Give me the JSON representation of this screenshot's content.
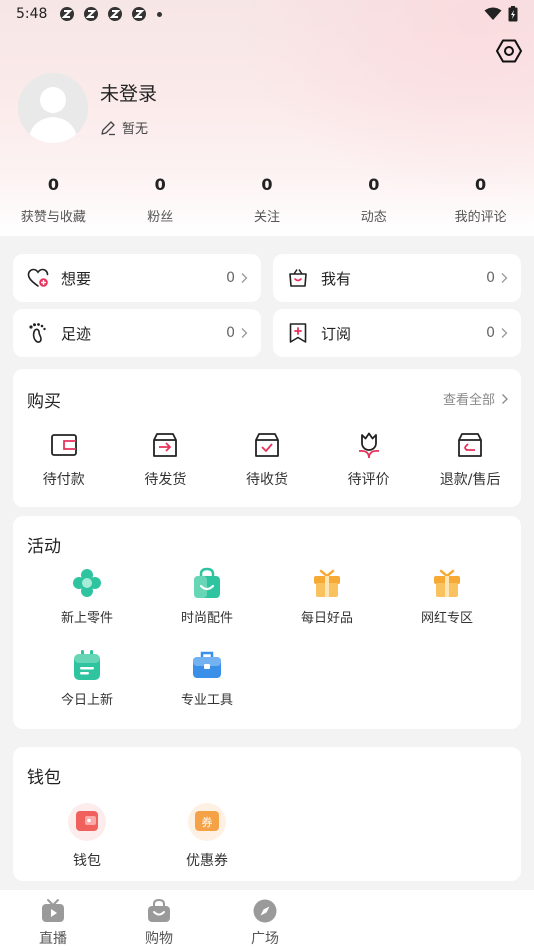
{
  "status_bar": {
    "time": "5:48"
  },
  "profile": {
    "username": "未登录",
    "bio": "暂无"
  },
  "stats": [
    {
      "value": "0",
      "label": "获赞与收藏"
    },
    {
      "value": "0",
      "label": "粉丝"
    },
    {
      "value": "0",
      "label": "关注"
    },
    {
      "value": "0",
      "label": "动态"
    },
    {
      "value": "0",
      "label": "我的评论"
    }
  ],
  "quick": [
    {
      "label": "想要",
      "count": "0",
      "icon": "heart-plus-icon"
    },
    {
      "label": "我有",
      "count": "0",
      "icon": "basket-icon"
    },
    {
      "label": "足迹",
      "count": "0",
      "icon": "footprint-icon"
    },
    {
      "label": "订阅",
      "count": "0",
      "icon": "bookmark-plus-icon"
    }
  ],
  "purchase": {
    "title": "购买",
    "view_all": "查看全部",
    "items": [
      {
        "label": "待付款",
        "icon": "wallet-outline-icon"
      },
      {
        "label": "待发货",
        "icon": "box-arrow-icon"
      },
      {
        "label": "待收货",
        "icon": "box-check-icon"
      },
      {
        "label": "待评价",
        "icon": "tulip-icon"
      },
      {
        "label": "退款/售后",
        "icon": "box-return-icon"
      }
    ]
  },
  "activity": {
    "title": "活动",
    "items": [
      {
        "label": "新上零件",
        "icon": "flower-icon"
      },
      {
        "label": "时尚配件",
        "icon": "shopping-bag-icon"
      },
      {
        "label": "每日好品",
        "icon": "gift-icon"
      },
      {
        "label": "网红专区",
        "icon": "gift-icon"
      },
      {
        "label": "今日上新",
        "icon": "calendar-icon"
      },
      {
        "label": "专业工具",
        "icon": "toolbox-icon"
      }
    ]
  },
  "wallet": {
    "title": "钱包",
    "items": [
      {
        "label": "钱包",
        "icon": "wallet-icon"
      },
      {
        "label": "优惠券",
        "icon": "coupon-icon"
      }
    ]
  },
  "nav": [
    {
      "label": "直播",
      "icon": "tv-play-icon"
    },
    {
      "label": "购物",
      "icon": "shopping-bag-icon"
    },
    {
      "label": "广场",
      "icon": "compass-icon"
    }
  ],
  "colors": {
    "accent": "#e8315b",
    "teal": "#2fc4a0",
    "orange": "#f7a936",
    "blue": "#3a8fe8",
    "coupon": "#f5a146"
  }
}
